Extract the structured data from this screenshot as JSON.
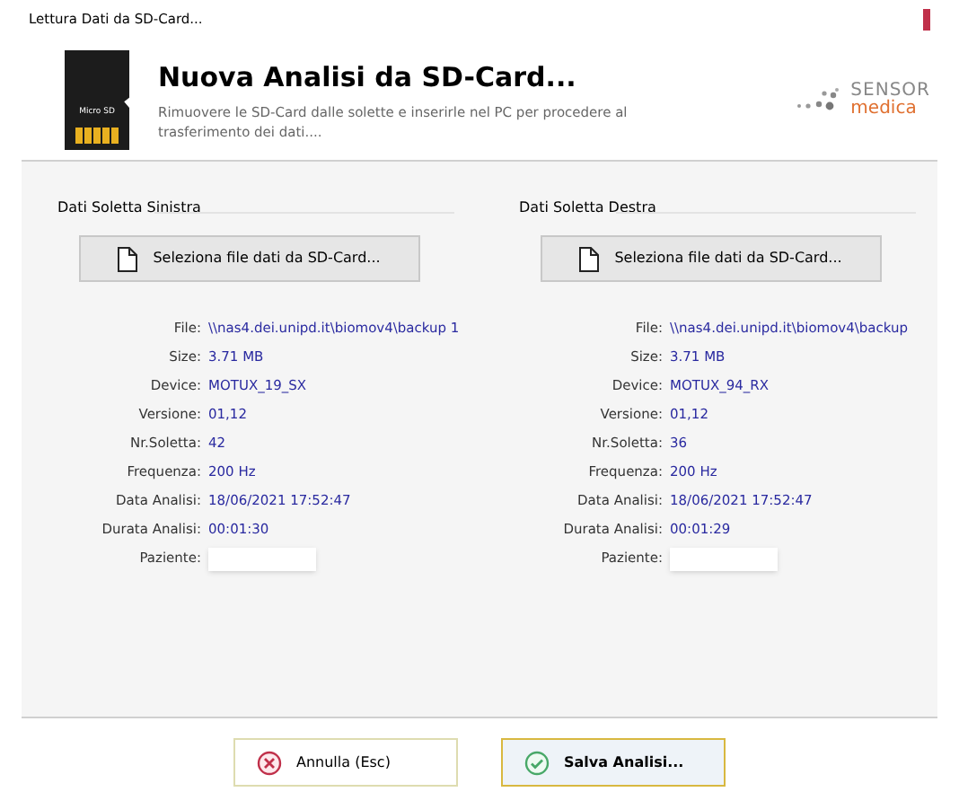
{
  "window": {
    "title": "Lettura Dati da SD-Card..."
  },
  "header": {
    "card_label": "Micro SD",
    "title": "Nuova Analisi da SD-Card...",
    "subtitle": "Rimuovere le SD-Card dalle solette e inserirle nel PC per procedere al trasferimento dei dati....",
    "logo_top": "SENSOR",
    "logo_bottom": "medica"
  },
  "panels": [
    {
      "title": "Dati Soletta Sinistra",
      "button": "Seleziona file dati da SD-Card...",
      "fields": [
        {
          "label": "File:",
          "value": "\\\\nas4.dei.unipd.it\\biomov4\\backup 1"
        },
        {
          "label": "Size:",
          "value": "3.71 MB"
        },
        {
          "label": "Device:",
          "value": "MOTUX_19_SX"
        },
        {
          "label": "Versione:",
          "value": "01,12"
        },
        {
          "label": "Nr.Soletta:",
          "value": "42"
        },
        {
          "label": "Frequenza:",
          "value": "200 Hz"
        },
        {
          "label": "Data Analisi:",
          "value": "18/06/2021  17:52:47"
        },
        {
          "label": "Durata Analisi:",
          "value": "00:01:30"
        }
      ],
      "patient_label": "Paziente:"
    },
    {
      "title": "Dati Soletta Destra",
      "button": "Seleziona file dati da SD-Card...",
      "fields": [
        {
          "label": "File:",
          "value": "\\\\nas4.dei.unipd.it\\biomov4\\backup"
        },
        {
          "label": "Size:",
          "value": "3.71 MB"
        },
        {
          "label": "Device:",
          "value": "MOTUX_94_RX"
        },
        {
          "label": "Versione:",
          "value": "01,12"
        },
        {
          "label": "Nr.Soletta:",
          "value": "36"
        },
        {
          "label": "Frequenza:",
          "value": "200 Hz"
        },
        {
          "label": "Data Analisi:",
          "value": "18/06/2021  17:52:47"
        },
        {
          "label": "Durata Analisi:",
          "value": "00:01:29"
        }
      ],
      "patient_label": "Paziente:"
    }
  ],
  "buttons": [
    {
      "label": "Annulla (Esc)",
      "kind": "cancel",
      "selected": false
    },
    {
      "label": "Salva Analisi...",
      "kind": "save",
      "selected": true
    }
  ]
}
